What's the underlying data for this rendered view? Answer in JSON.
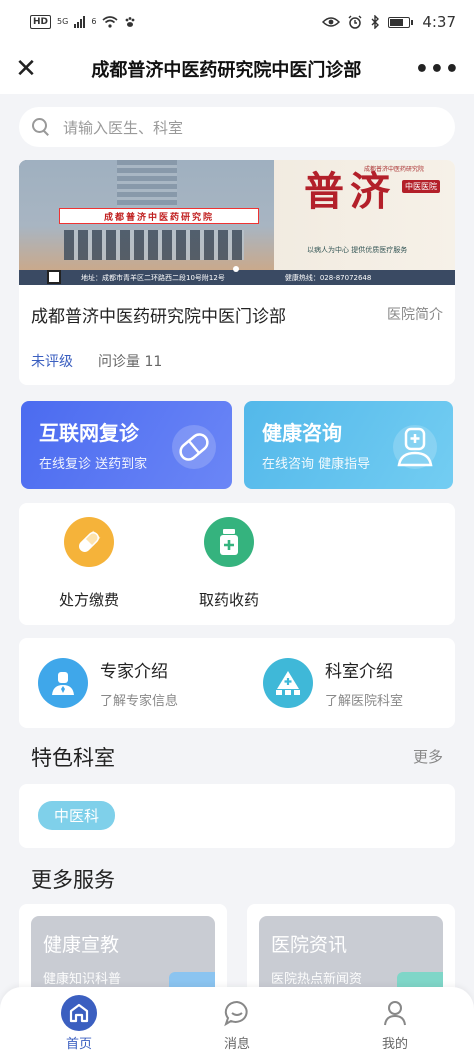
{
  "status_bar": {
    "network_badge": "HD",
    "signal_1": "5G",
    "signal_2": "6",
    "time": "4:37",
    "icons": [
      "eye-icon",
      "alarm-icon",
      "bluetooth-icon",
      "battery-icon"
    ]
  },
  "nav": {
    "title": "成都普济中医药研究院中医门诊部",
    "close_icon": "close-icon",
    "more_icon": "more-icon"
  },
  "search": {
    "placeholder": "请输入医生、科室"
  },
  "hospital": {
    "name": "成都普济中医药研究院中医门诊部",
    "intro_link": "医院简介",
    "grade": "未评级",
    "consult_count": "问诊量 11",
    "banner": {
      "sign": "成都普济中医药研究院",
      "headline": "普济",
      "badge": "中医医院",
      "slogan": "以病人为中心 提供优质医疗服务",
      "footer_address": "地址：成都市青羊区二环路西二段10号附12号",
      "footer_phone": "健康热线：028-87072648",
      "logo_text": "成都普济中医药研究院"
    }
  },
  "services": [
    {
      "title": "互联网复诊",
      "subtitle": "在线复诊 送药到家",
      "icon": "capsule-icon",
      "color": "#4b6bf0"
    },
    {
      "title": "健康咨询",
      "subtitle": "在线咨询 健康指导",
      "icon": "doctor-icon",
      "color": "#53b8ea"
    }
  ],
  "quick_actions": [
    {
      "label": "处方缴费",
      "icon": "pill-icon",
      "color": "#f5b33a"
    },
    {
      "label": "取药收药",
      "icon": "medicine-bottle-icon",
      "color": "#35b37e"
    }
  ],
  "info_links": [
    {
      "title": "专家介绍",
      "subtitle": "了解专家信息",
      "icon": "expert-icon",
      "color": "#3fa7ea"
    },
    {
      "title": "科室介绍",
      "subtitle": "了解医院科室",
      "icon": "department-icon",
      "color": "#3fb8d8"
    }
  ],
  "featured": {
    "title": "特色科室",
    "more": "更多",
    "tags": [
      "中医科"
    ]
  },
  "more_services": {
    "title": "更多服务",
    "cards": [
      {
        "title": "健康宣教",
        "subtitle": "健康知识科普"
      },
      {
        "title": "医院资讯",
        "subtitle": "医院热点新闻资"
      }
    ]
  },
  "tabs": [
    {
      "label": "首页",
      "icon": "home-icon",
      "active": true
    },
    {
      "label": "消息",
      "icon": "message-icon",
      "active": false
    },
    {
      "label": "我的",
      "icon": "profile-icon",
      "active": false
    }
  ],
  "colors": {
    "accent": "#3b5fc0",
    "background": "#f3f4f7"
  }
}
